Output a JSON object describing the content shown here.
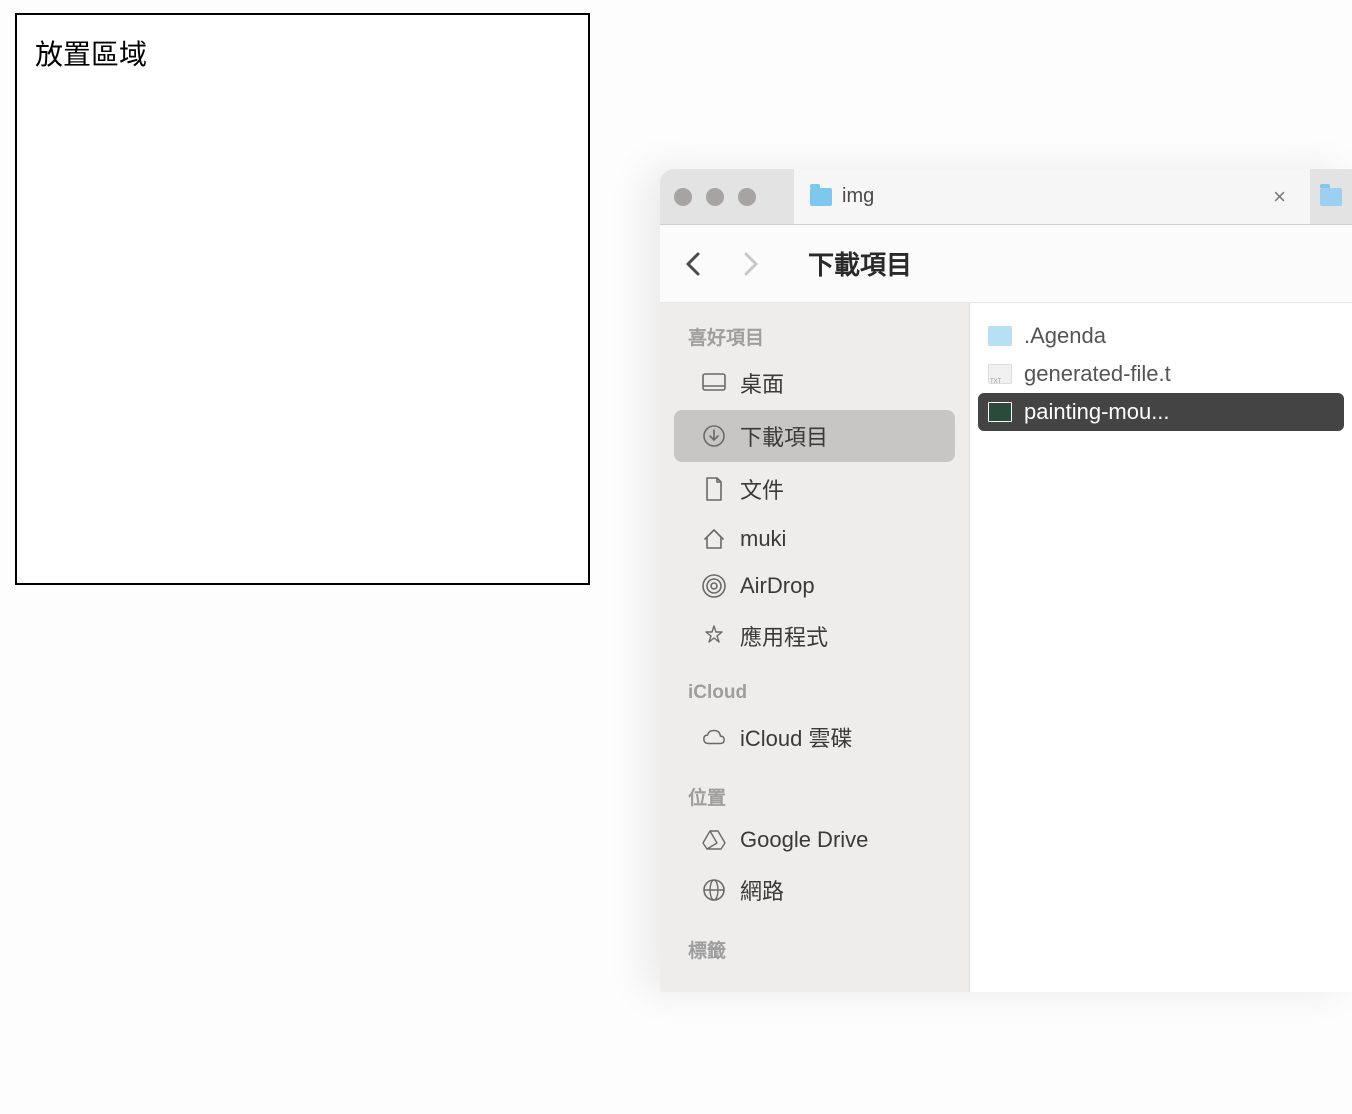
{
  "dropZone": {
    "title": "放置區域"
  },
  "finder": {
    "tabs": [
      {
        "label": "img",
        "active": true
      }
    ],
    "toolbar": {
      "title": "下載項目"
    },
    "sidebar": {
      "sections": [
        {
          "header": "喜好項目",
          "items": [
            {
              "icon": "desktop",
              "label": "桌面",
              "selected": false
            },
            {
              "icon": "download",
              "label": "下載項目",
              "selected": true
            },
            {
              "icon": "document",
              "label": "文件",
              "selected": false
            },
            {
              "icon": "home",
              "label": "muki",
              "selected": false
            },
            {
              "icon": "airdrop",
              "label": "AirDrop",
              "selected": false
            },
            {
              "icon": "apps",
              "label": "應用程式",
              "selected": false
            }
          ]
        },
        {
          "header": "iCloud",
          "items": [
            {
              "icon": "cloud",
              "label": "iCloud 雲碟",
              "selected": false
            }
          ]
        },
        {
          "header": "位置",
          "items": [
            {
              "icon": "gdrive",
              "label": "Google Drive",
              "selected": false
            },
            {
              "icon": "network",
              "label": "網路",
              "selected": false
            }
          ]
        },
        {
          "header": "標籤",
          "items": []
        }
      ]
    },
    "files": [
      {
        "type": "folder",
        "name": ".Agenda",
        "selected": false
      },
      {
        "type": "txt",
        "name": "generated-file.t",
        "selected": false
      },
      {
        "type": "image",
        "name": "painting-mou...",
        "selected": true
      }
    ]
  }
}
